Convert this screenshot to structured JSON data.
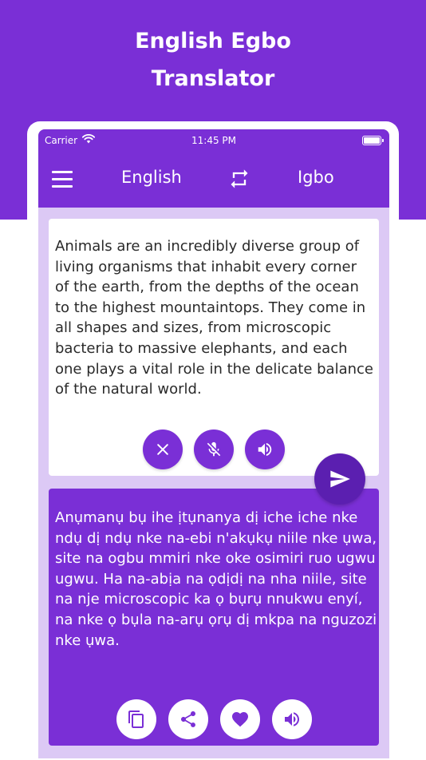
{
  "promo": {
    "title_line1": "English Egbo",
    "title_line2": "Translator"
  },
  "statusbar": {
    "carrier": "Carrier",
    "time": "11:45 PM"
  },
  "appbar": {
    "source_language": "English",
    "target_language": "Igbo"
  },
  "input": {
    "text": "Animals are an incredibly diverse group of living organisms that inhabit every corner of the earth, from the depths of the ocean to the highest mountaintops. They come in all shapes and sizes, from microscopic bacteria to massive elephants, and each one plays a vital role in the delicate balance of the natural world."
  },
  "output": {
    "text": "Anụmanụ bụ ihe ịtụnanya dị iche iche nke ndụ dị ndụ nke na-ebi n'akụkụ niile nke ụwa, site na ogbu mmiri nke oke osimiri ruo ugwu ugwu. Ha na-abịa na ọdịdị na nha niile, site na nje microscopic ka ọ bụrụ nnukwu enyí, na nke ọ bụla na-arụ ọrụ dị mkpa na nguzozi nke ụwa."
  },
  "icons": {
    "menu": "menu-icon",
    "swap": "swap-icon",
    "clear": "close-icon",
    "mic": "mic-off-icon",
    "speaker": "speaker-icon",
    "send": "send-icon",
    "copy": "copy-icon",
    "share": "share-icon",
    "favorite": "heart-icon"
  },
  "colors": {
    "primary": "#7a2fd6",
    "primary_dark": "#5b1fb0",
    "screen_bg": "#dcc9f5"
  }
}
